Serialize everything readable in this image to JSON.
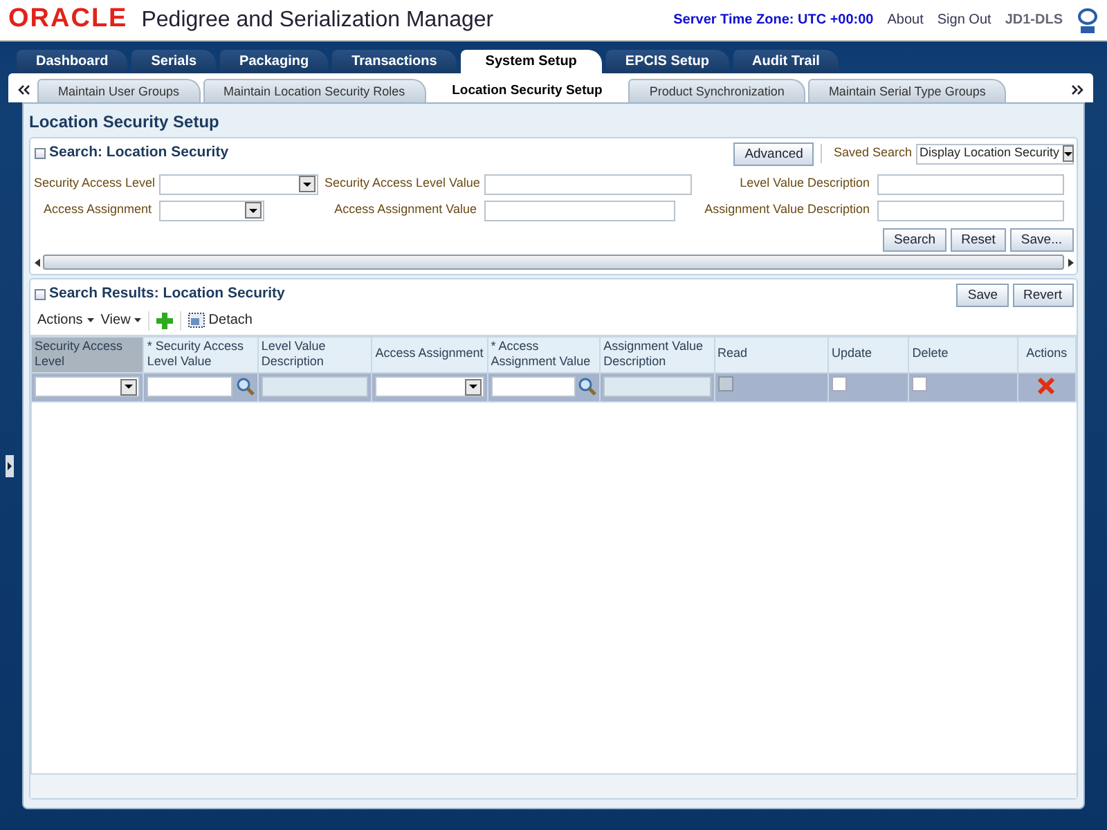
{
  "header": {
    "logo": "ORACLE",
    "app_title": "Pedigree and Serialization Manager",
    "server_time": "Server Time Zone: UTC +00:00",
    "links": [
      "About",
      "Sign Out"
    ],
    "user": "JD1-DLS"
  },
  "tabs": [
    {
      "label": "Dashboard",
      "selected": false
    },
    {
      "label": "Serials",
      "selected": false
    },
    {
      "label": "Packaging",
      "selected": false
    },
    {
      "label": "Transactions",
      "selected": false
    },
    {
      "label": "System Setup",
      "selected": true
    },
    {
      "label": "EPCIS Setup",
      "selected": false
    },
    {
      "label": "Audit Trail",
      "selected": false
    }
  ],
  "subtabs": [
    {
      "label": "Maintain User Groups",
      "selected": false
    },
    {
      "label": "Maintain Location Security Roles",
      "selected": false
    },
    {
      "label": "Location Security Setup",
      "selected": true
    },
    {
      "label": "Product Synchronization",
      "selected": false
    },
    {
      "label": "Maintain Serial Type Groups",
      "selected": false
    }
  ],
  "page_title": "Location Security Setup",
  "search": {
    "title": "Search: Location Security",
    "advanced": "Advanced",
    "saved_search_label": "Saved Search",
    "saved_search_value": "Display Location Security",
    "fields": [
      {
        "label": "Security Access Level",
        "kind": "select"
      },
      {
        "label": "Security Access Level Value",
        "kind": "text"
      },
      {
        "label": "Level Value Description",
        "kind": "text"
      },
      {
        "label": "Access Assignment",
        "kind": "select"
      },
      {
        "label": "Access Assignment Value",
        "kind": "text"
      },
      {
        "label": "Assignment Value Description",
        "kind": "text"
      }
    ],
    "buttons": [
      "Search",
      "Reset",
      "Save..."
    ]
  },
  "results": {
    "title": "Search Results: Location Security",
    "buttons": [
      "Save",
      "Revert"
    ],
    "menus": [
      "Actions",
      "View"
    ],
    "detach": "Detach",
    "columns": [
      {
        "label": "Security Access Level",
        "selected": true,
        "kind": "select"
      },
      {
        "label": "* Security Access Level Value",
        "selected": false,
        "kind": "lookup"
      },
      {
        "label": "Level Value Description",
        "selected": false,
        "kind": "readonly"
      },
      {
        "label": "Access Assignment",
        "selected": false,
        "kind": "select"
      },
      {
        "label": "* Access Assignment Value",
        "selected": false,
        "kind": "lookup"
      },
      {
        "label": "Assignment Value Description",
        "selected": false,
        "kind": "readonly"
      },
      {
        "label": "Read",
        "selected": false,
        "kind": "checkbox",
        "checked": false,
        "disabled": true
      },
      {
        "label": "Update",
        "selected": false,
        "kind": "checkbox",
        "checked": false,
        "disabled": false
      },
      {
        "label": "Delete",
        "selected": false,
        "kind": "checkbox",
        "checked": false,
        "disabled": false
      },
      {
        "label": "Actions",
        "selected": false,
        "kind": "delete"
      }
    ],
    "row_selected": true
  }
}
